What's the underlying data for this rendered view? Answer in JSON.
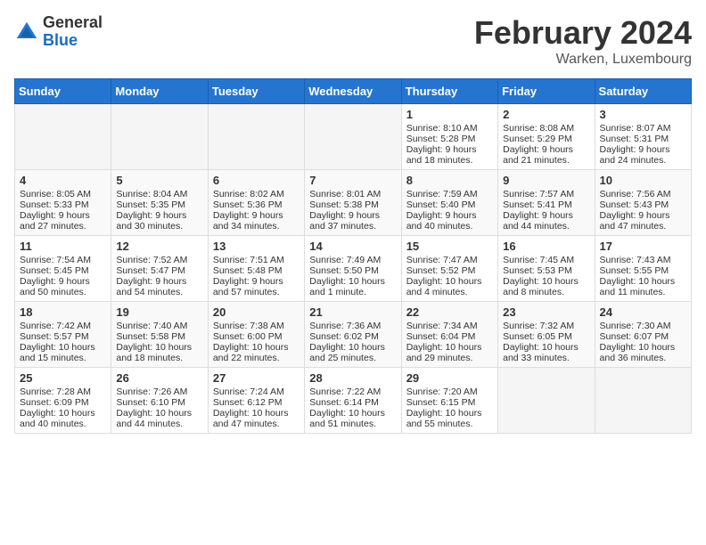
{
  "header": {
    "logo_general": "General",
    "logo_blue": "Blue",
    "title": "February 2024",
    "location": "Warken, Luxembourg"
  },
  "days_of_week": [
    "Sunday",
    "Monday",
    "Tuesday",
    "Wednesday",
    "Thursday",
    "Friday",
    "Saturday"
  ],
  "weeks": [
    [
      {
        "day": "",
        "info": ""
      },
      {
        "day": "",
        "info": ""
      },
      {
        "day": "",
        "info": ""
      },
      {
        "day": "",
        "info": ""
      },
      {
        "day": "1",
        "info": "Sunrise: 8:10 AM\nSunset: 5:28 PM\nDaylight: 9 hours and 18 minutes."
      },
      {
        "day": "2",
        "info": "Sunrise: 8:08 AM\nSunset: 5:29 PM\nDaylight: 9 hours and 21 minutes."
      },
      {
        "day": "3",
        "info": "Sunrise: 8:07 AM\nSunset: 5:31 PM\nDaylight: 9 hours and 24 minutes."
      }
    ],
    [
      {
        "day": "4",
        "info": "Sunrise: 8:05 AM\nSunset: 5:33 PM\nDaylight: 9 hours and 27 minutes."
      },
      {
        "day": "5",
        "info": "Sunrise: 8:04 AM\nSunset: 5:35 PM\nDaylight: 9 hours and 30 minutes."
      },
      {
        "day": "6",
        "info": "Sunrise: 8:02 AM\nSunset: 5:36 PM\nDaylight: 9 hours and 34 minutes."
      },
      {
        "day": "7",
        "info": "Sunrise: 8:01 AM\nSunset: 5:38 PM\nDaylight: 9 hours and 37 minutes."
      },
      {
        "day": "8",
        "info": "Sunrise: 7:59 AM\nSunset: 5:40 PM\nDaylight: 9 hours and 40 minutes."
      },
      {
        "day": "9",
        "info": "Sunrise: 7:57 AM\nSunset: 5:41 PM\nDaylight: 9 hours and 44 minutes."
      },
      {
        "day": "10",
        "info": "Sunrise: 7:56 AM\nSunset: 5:43 PM\nDaylight: 9 hours and 47 minutes."
      }
    ],
    [
      {
        "day": "11",
        "info": "Sunrise: 7:54 AM\nSunset: 5:45 PM\nDaylight: 9 hours and 50 minutes."
      },
      {
        "day": "12",
        "info": "Sunrise: 7:52 AM\nSunset: 5:47 PM\nDaylight: 9 hours and 54 minutes."
      },
      {
        "day": "13",
        "info": "Sunrise: 7:51 AM\nSunset: 5:48 PM\nDaylight: 9 hours and 57 minutes."
      },
      {
        "day": "14",
        "info": "Sunrise: 7:49 AM\nSunset: 5:50 PM\nDaylight: 10 hours and 1 minute."
      },
      {
        "day": "15",
        "info": "Sunrise: 7:47 AM\nSunset: 5:52 PM\nDaylight: 10 hours and 4 minutes."
      },
      {
        "day": "16",
        "info": "Sunrise: 7:45 AM\nSunset: 5:53 PM\nDaylight: 10 hours and 8 minutes."
      },
      {
        "day": "17",
        "info": "Sunrise: 7:43 AM\nSunset: 5:55 PM\nDaylight: 10 hours and 11 minutes."
      }
    ],
    [
      {
        "day": "18",
        "info": "Sunrise: 7:42 AM\nSunset: 5:57 PM\nDaylight: 10 hours and 15 minutes."
      },
      {
        "day": "19",
        "info": "Sunrise: 7:40 AM\nSunset: 5:58 PM\nDaylight: 10 hours and 18 minutes."
      },
      {
        "day": "20",
        "info": "Sunrise: 7:38 AM\nSunset: 6:00 PM\nDaylight: 10 hours and 22 minutes."
      },
      {
        "day": "21",
        "info": "Sunrise: 7:36 AM\nSunset: 6:02 PM\nDaylight: 10 hours and 25 minutes."
      },
      {
        "day": "22",
        "info": "Sunrise: 7:34 AM\nSunset: 6:04 PM\nDaylight: 10 hours and 29 minutes."
      },
      {
        "day": "23",
        "info": "Sunrise: 7:32 AM\nSunset: 6:05 PM\nDaylight: 10 hours and 33 minutes."
      },
      {
        "day": "24",
        "info": "Sunrise: 7:30 AM\nSunset: 6:07 PM\nDaylight: 10 hours and 36 minutes."
      }
    ],
    [
      {
        "day": "25",
        "info": "Sunrise: 7:28 AM\nSunset: 6:09 PM\nDaylight: 10 hours and 40 minutes."
      },
      {
        "day": "26",
        "info": "Sunrise: 7:26 AM\nSunset: 6:10 PM\nDaylight: 10 hours and 44 minutes."
      },
      {
        "day": "27",
        "info": "Sunrise: 7:24 AM\nSunset: 6:12 PM\nDaylight: 10 hours and 47 minutes."
      },
      {
        "day": "28",
        "info": "Sunrise: 7:22 AM\nSunset: 6:14 PM\nDaylight: 10 hours and 51 minutes."
      },
      {
        "day": "29",
        "info": "Sunrise: 7:20 AM\nSunset: 6:15 PM\nDaylight: 10 hours and 55 minutes."
      },
      {
        "day": "",
        "info": ""
      },
      {
        "day": "",
        "info": ""
      }
    ]
  ]
}
